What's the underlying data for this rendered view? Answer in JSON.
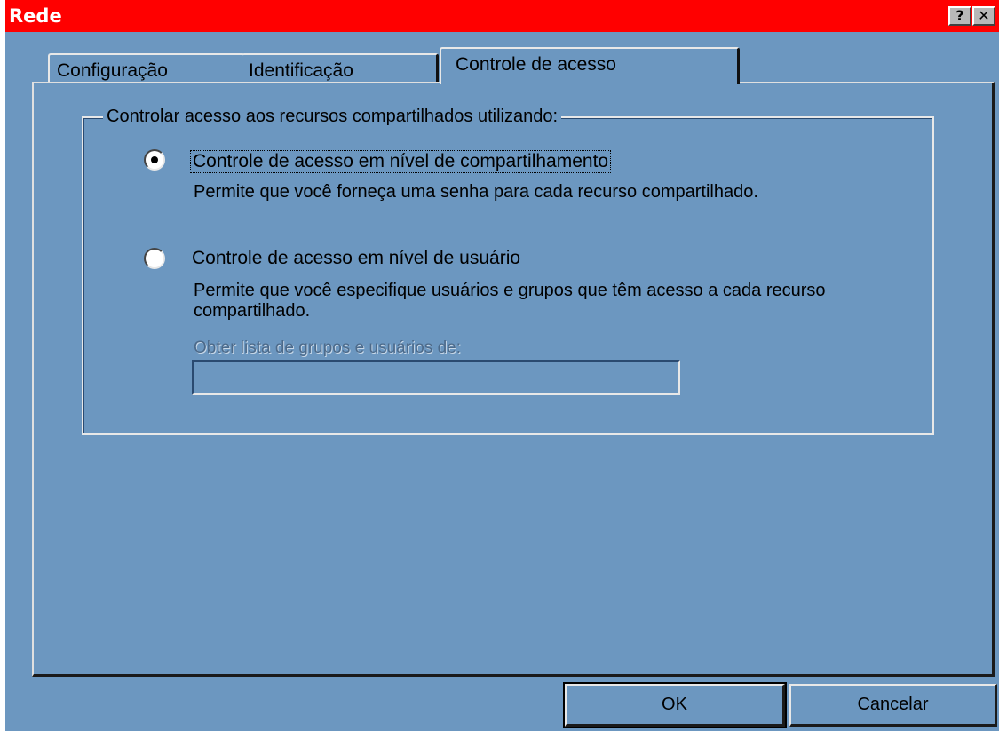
{
  "window": {
    "title": "Rede",
    "help_glyph": "?",
    "close_glyph": "✕",
    "title_bar_color": "#ff0000",
    "face_color": "#6c97c0"
  },
  "tabs": [
    {
      "label": "Configuração",
      "active": false
    },
    {
      "label": "Identificação",
      "active": false
    },
    {
      "label": "Controle de acesso",
      "active": true
    }
  ],
  "group": {
    "label": "Controlar acesso aos recursos compartilhados utilizando:",
    "options": [
      {
        "label": "Controle de acesso em nível de compartilhamento",
        "description": "Permite que você forneça uma senha para cada recurso compartilhado.",
        "selected": true
      },
      {
        "label": "Controle de acesso em nível de usuário",
        "description": "Permite que você especifique usuários e grupos que têm acesso a cada recurso compartilhado.",
        "selected": false
      }
    ],
    "list_source_label": "Obter lista de grupos e usuários de:",
    "list_source_value": ""
  },
  "buttons": {
    "ok": "OK",
    "cancel": "Cancelar"
  }
}
